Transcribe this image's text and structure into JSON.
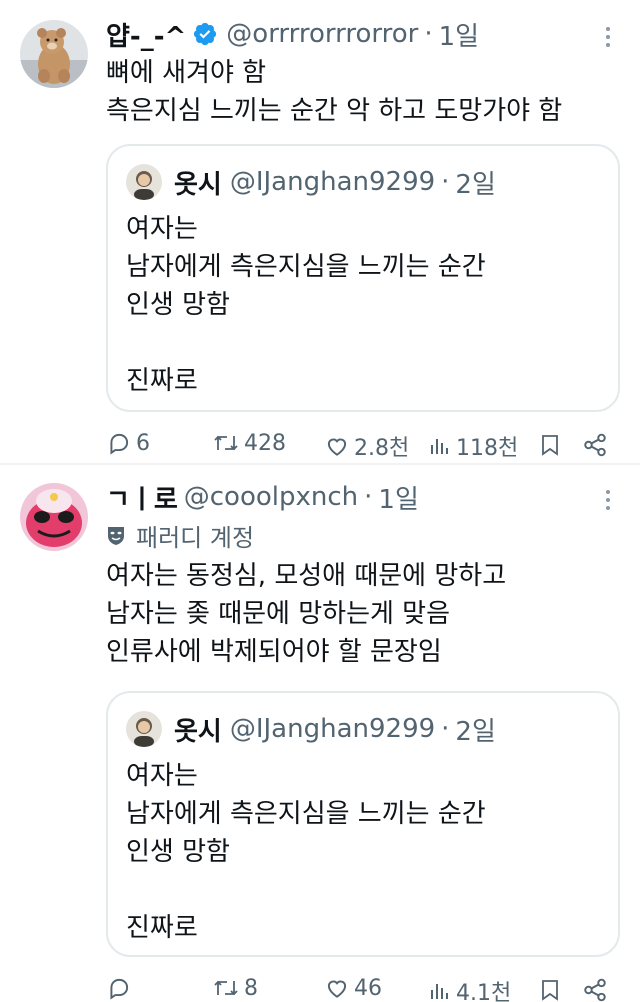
{
  "tweets": [
    {
      "display_name": "얍-_-^",
      "handle": "@orrrrorrrorror",
      "dot": "·",
      "time": "1일",
      "verified": true,
      "avatar_icon": "bear-avatar",
      "text_lines": [
        "뼈에 새겨야 함",
        "측은지심 느끼는 순간 악 하고 도망가야 함"
      ],
      "quote": {
        "display_name": "옷시",
        "handle": "@IJanghan9299",
        "dot": "·",
        "time": "2일",
        "lines": [
          "여자는",
          "남자에게 측은지심을 느끼는 순간",
          "인생 망함",
          "",
          "진짜로"
        ]
      },
      "actions": {
        "replies": "6",
        "retweets": "428",
        "likes": "2.8천",
        "views": "118천"
      }
    },
    {
      "display_name": "ㄱㅣ로",
      "handle": "@cooolpxnch",
      "dot": "·",
      "time": "1일",
      "parody_label": "패러디 계정",
      "avatar_icon": "pink-frog-avatar",
      "text_lines": [
        "여자는 동정심, 모성애 때문에 망하고",
        "남자는 좆 때문에 망하는게 맞음",
        "인류사에 박제되어야 할 문장임"
      ],
      "quote": {
        "display_name": "옷시",
        "handle": "@IJanghan9299",
        "dot": "·",
        "time": "2일",
        "lines": [
          "여자는",
          "남자에게 측은지심을 느끼는 순간",
          "인생 망함",
          "",
          "진짜로"
        ]
      },
      "actions": {
        "replies": "",
        "retweets": "8",
        "likes": "46",
        "views": "4.1천"
      }
    }
  ],
  "colors": {
    "text": "#0f1419",
    "secondary": "#536471",
    "verified": "#1d9bf0",
    "border": "#e4e9ec"
  }
}
